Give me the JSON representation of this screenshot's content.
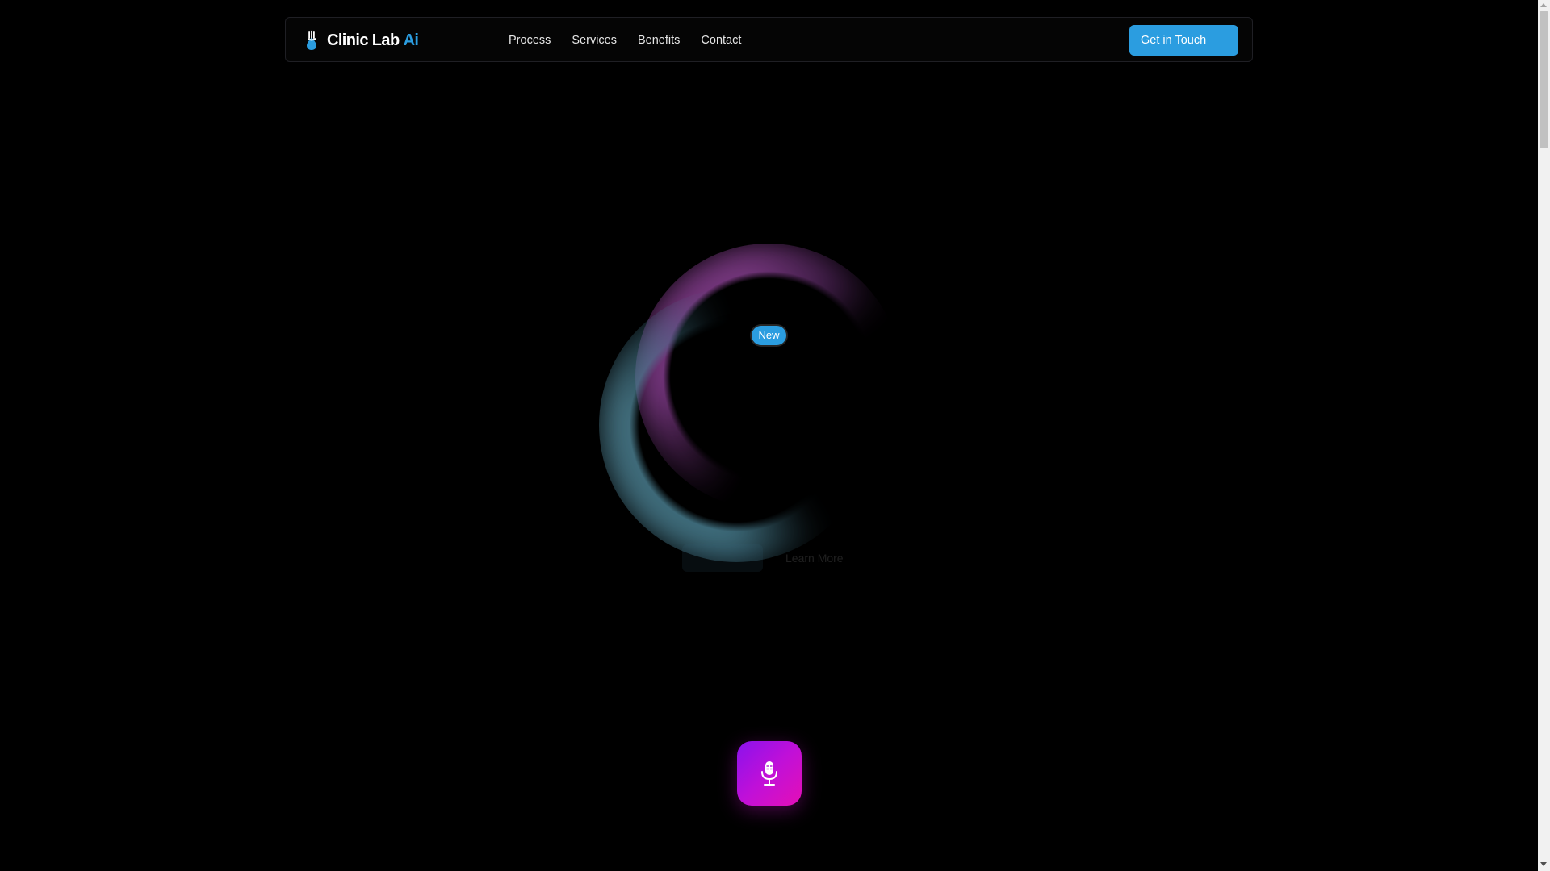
{
  "brand": {
    "name": "Clinic Lab",
    "accent": "Ai",
    "icon": "hand-drop-icon",
    "accent_color": "#2b9de0"
  },
  "nav": {
    "links": [
      {
        "label": "Process"
      },
      {
        "label": "Services"
      },
      {
        "label": "Benefits"
      },
      {
        "label": "Contact"
      }
    ],
    "cta_label": "Get in Touch"
  },
  "hero": {
    "badge": "New",
    "primary_action_label": "",
    "secondary_action_label": "Learn More",
    "orb_colors": {
      "purple": "#8c4096",
      "blue": "#508ca0"
    }
  },
  "voice": {
    "icon": "microphone-icon",
    "gradient_start": "#8a12ec",
    "gradient_end": "#e40fb6"
  },
  "colors": {
    "background": "#000000",
    "primary": "#2b9de0"
  }
}
